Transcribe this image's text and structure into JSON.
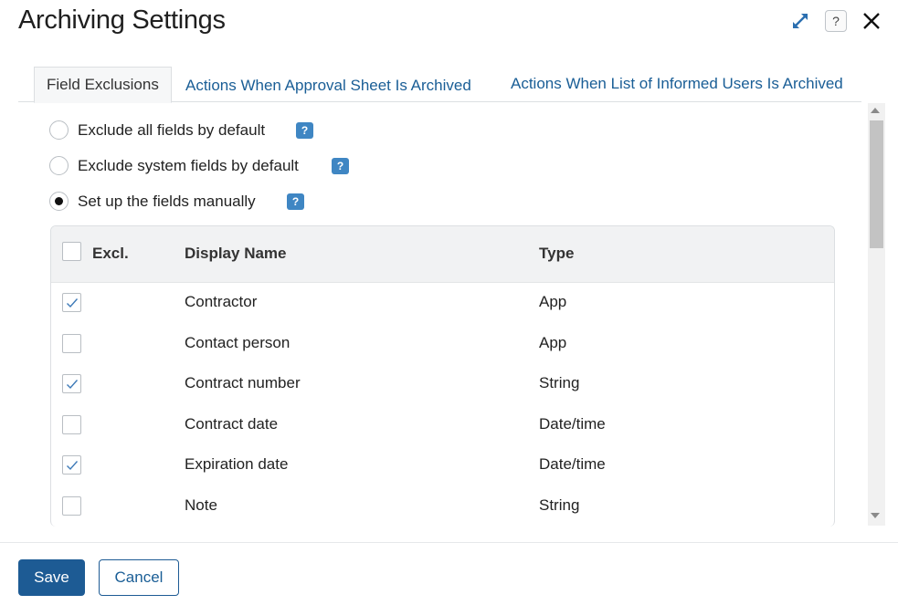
{
  "dialog": {
    "title": "Archiving Settings",
    "help_glyph": "?"
  },
  "tabs": [
    {
      "label": "Field Exclusions",
      "active": true
    },
    {
      "label": "Actions When Approval Sheet Is Archived",
      "active": false
    },
    {
      "label": "Actions When List of Informed Users Is Archived",
      "active": false
    }
  ],
  "options": [
    {
      "label": "Exclude all fields by default",
      "selected": false
    },
    {
      "label": "Exclude system fields by default",
      "selected": false
    },
    {
      "label": "Set up the fields manually",
      "selected": true
    }
  ],
  "help_mark": "?",
  "table": {
    "headers": {
      "excl": "Excl.",
      "name": "Display Name",
      "type": "Type"
    },
    "rows": [
      {
        "checked": true,
        "name": "Contractor",
        "type": "App"
      },
      {
        "checked": false,
        "name": "Contact person",
        "type": "App"
      },
      {
        "checked": true,
        "name": "Contract number",
        "type": "String"
      },
      {
        "checked": false,
        "name": "Contract date",
        "type": "Date/time"
      },
      {
        "checked": true,
        "name": "Expiration date",
        "type": "Date/time"
      },
      {
        "checked": false,
        "name": "Note",
        "type": "String"
      }
    ]
  },
  "footer": {
    "save_label": "Save",
    "cancel_label": "Cancel"
  },
  "colors": {
    "accent": "#1d5b94",
    "link": "#1a5e96",
    "help_badge": "#3f86c3"
  }
}
